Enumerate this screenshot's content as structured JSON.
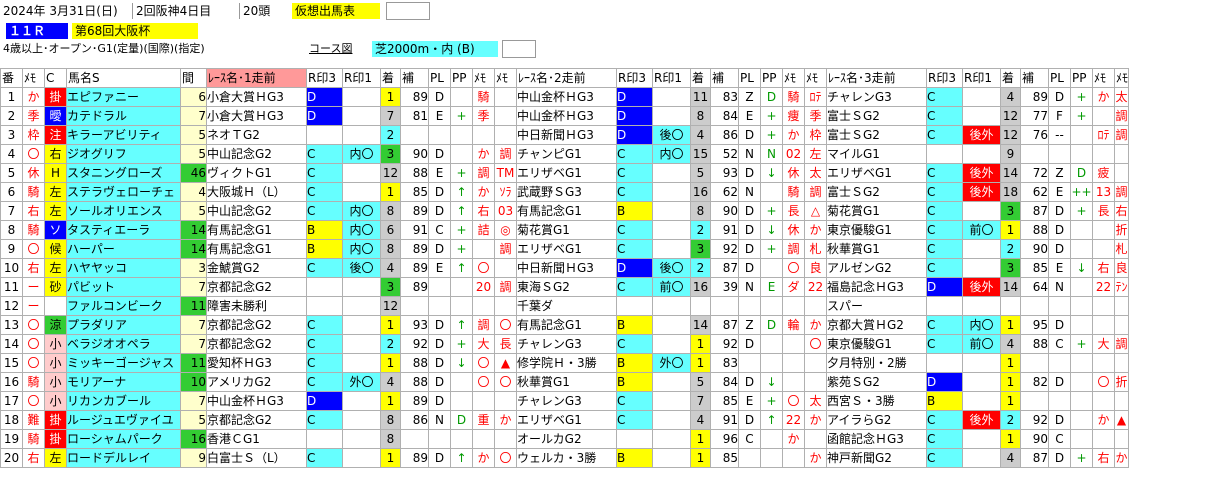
{
  "header": {
    "line1": {
      "date": "2024年  3月31日(日)",
      "meeting": "2回阪神4日目",
      "heads": "20頭",
      "card_type": "仮想出馬表"
    },
    "line2": {
      "race_no": "１１Ｒ",
      "race_name": "第68回大阪杯"
    },
    "line3": {
      "conditions": "4歳以上･オープン･G1(定量)(国際)(指定)",
      "course_label": "コース図",
      "course": "芝2000m・内 (B)"
    }
  },
  "columns": [
    "番",
    "ﾒﾓ",
    "C",
    "馬名S",
    "間",
    "ﾚｰｽ名･1走前",
    "R印3",
    "R印1",
    "着",
    "補",
    "PL",
    "PP",
    "ﾒﾓ",
    "ﾒﾓ",
    "ﾚｰｽ名･2走前",
    "R印3",
    "R印1",
    "着",
    "補",
    "PL",
    "PP",
    "ﾒﾓ",
    "ﾒﾓ",
    "ﾚｰｽ名･3走前",
    "R印3",
    "R印1",
    "着",
    "補",
    "PL",
    "PP",
    "ﾒﾓ",
    "ﾒﾓ"
  ],
  "rows": [
    {
      "no": "1",
      "memo": "か",
      "c": "掛",
      "name": "エピファニー",
      "gap": "6",
      "r1": {
        "race": "小倉大賞ＨG3",
        "ri3": "D",
        "ri1": "",
        "pos": "1",
        "ho": "89",
        "pl": "D",
        "pp": "",
        "m1": "騎",
        "m2": ""
      },
      "r2": {
        "race": "中山金杯ＨG3",
        "ri3": "D",
        "ri1": "",
        "pos": "11",
        "ho": "83",
        "pl": "Z",
        "pp": "D",
        "m1": "騎",
        "m2": "ﾛﾃ"
      },
      "r3": {
        "race": "チャレンG3",
        "ri3": "C",
        "ri1": "",
        "pos": "4",
        "ho": "89",
        "pl": "D",
        "pp": "+",
        "m1": "か",
        "m2": "太"
      }
    },
    {
      "no": "2",
      "memo": "季",
      "c": "曖",
      "name": "カテドラル",
      "gap": "7",
      "r1": {
        "race": "小倉大賞ＨG3",
        "ri3": "D",
        "ri1": "",
        "pos": "7",
        "ho": "81",
        "pl": "E",
        "pp": "+",
        "m1": "季",
        "m2": ""
      },
      "r2": {
        "race": "中山金杯ＨG3",
        "ri3": "D",
        "ri1": "",
        "pos": "8",
        "ho": "84",
        "pl": "E",
        "pp": "+",
        "m1": "痩",
        "m2": "季"
      },
      "r3": {
        "race": "富士ＳG2",
        "ri3": "C",
        "ri1": "",
        "pos": "12",
        "ho": "77",
        "pl": "F",
        "pp": "+",
        "m1": "",
        "m2": "調"
      }
    },
    {
      "no": "3",
      "memo": "枠",
      "c": "注",
      "name": "キラーアビリティ",
      "gap": "5",
      "r1": {
        "race": "ネオＴG2",
        "ri3": "",
        "ri1": "",
        "pos": "2",
        "ho": "",
        "pl": "",
        "pp": "",
        "m1": "",
        "m2": ""
      },
      "r2": {
        "race": "中日新聞ＨG3",
        "ri3": "D",
        "ri1": "後〇",
        "pos": "4",
        "ho": "86",
        "pl": "D",
        "pp": "+",
        "m1": "か",
        "m2": "枠"
      },
      "r3": {
        "race": "富士ＳG2",
        "ri3": "C",
        "ri1": "後外",
        "pos": "12",
        "ho": "76",
        "pl": "--",
        "pp": "",
        "m1": "ﾛﾃ",
        "m2": "調"
      }
    },
    {
      "no": "4",
      "memo": "〇",
      "c": "右",
      "name": "ジオグリフ",
      "gap": "5",
      "r1": {
        "race": "中山記念G2",
        "ri3": "C",
        "ri1": "内〇",
        "pos": "3",
        "ho": "90",
        "pl": "D",
        "pp": "",
        "m1": "か",
        "m2": "調"
      },
      "r2": {
        "race": "チャンピG1",
        "ri3": "C",
        "ri1": "内〇",
        "pos": "15",
        "ho": "52",
        "pl": "N",
        "pp": "N",
        "m1": "02",
        "m2": "左"
      },
      "r3": {
        "race": "マイルG1",
        "ri3": "",
        "ri1": "",
        "pos": "9",
        "ho": "",
        "pl": "",
        "pp": "",
        "m1": "",
        "m2": ""
      }
    },
    {
      "no": "5",
      "memo": "休",
      "c": "H",
      "name": "スタニングローズ",
      "gap": "46",
      "r1": {
        "race": "ヴィクトG1",
        "ri3": "C",
        "ri1": "",
        "pos": "12",
        "ho": "88",
        "pl": "E",
        "pp": "+",
        "m1": "調",
        "m2": "TM"
      },
      "r2": {
        "race": "エリザベG1",
        "ri3": "C",
        "ri1": "",
        "pos": "5",
        "ho": "93",
        "pl": "D",
        "pp": "↓",
        "m1": "休",
        "m2": "太"
      },
      "r3": {
        "race": "エリザベG1",
        "ri3": "C",
        "ri1": "後外",
        "pos": "14",
        "ho": "72",
        "pl": "Z",
        "pp": "D",
        "m1": "疲",
        "m2": ""
      }
    },
    {
      "no": "6",
      "memo": "騎",
      "c": "左",
      "name": "ステラヴェローチェ",
      "gap": "4",
      "r1": {
        "race": "大阪城Ｈ（L）",
        "ri3": "C",
        "ri1": "",
        "pos": "1",
        "ho": "85",
        "pl": "D",
        "pp": "↑",
        "m1": "か",
        "m2": "ｿﾗ"
      },
      "r2": {
        "race": "武蔵野ＳG3",
        "ri3": "C",
        "ri1": "",
        "pos": "16",
        "ho": "62",
        "pl": "N",
        "pp": "",
        "m1": "騎",
        "m2": "調"
      },
      "r3": {
        "race": "富士ＳG2",
        "ri3": "C",
        "ri1": "後外",
        "pos": "18",
        "ho": "62",
        "pl": "E",
        "pp": "++",
        "m1": "13",
        "m2": "調"
      }
    },
    {
      "no": "7",
      "memo": "右",
      "c": "左",
      "name": "ソールオリエンス",
      "gap": "5",
      "r1": {
        "race": "中山記念G2",
        "ri3": "C",
        "ri1": "内〇",
        "pos": "8",
        "ho": "89",
        "pl": "D",
        "pp": "↑",
        "m1": "右",
        "m2": "03"
      },
      "r2": {
        "race": "有馬記念G1",
        "ri3": "B",
        "ri1": "",
        "pos": "8",
        "ho": "90",
        "pl": "D",
        "pp": "+",
        "m1": "長",
        "m2": "△"
      },
      "r3": {
        "race": "菊花賞G1",
        "ri3": "C",
        "ri1": "",
        "pos": "3",
        "ho": "87",
        "pl": "D",
        "pp": "+",
        "m1": "長",
        "m2": "右"
      }
    },
    {
      "no": "8",
      "memo": "騎",
      "c": "ソ",
      "name": "タスティエーラ",
      "gap": "14",
      "r1": {
        "race": "有馬記念G1",
        "ri3": "B",
        "ri1": "内〇",
        "pos": "6",
        "ho": "91",
        "pl": "C",
        "pp": "+",
        "m1": "詰",
        "m2": "◎"
      },
      "r2": {
        "race": "菊花賞G1",
        "ri3": "C",
        "ri1": "",
        "pos": "2",
        "ho": "91",
        "pl": "D",
        "pp": "↓",
        "m1": "休",
        "m2": "か"
      },
      "r3": {
        "race": "東京優駿G1",
        "ri3": "C",
        "ri1": "前〇",
        "pos": "1",
        "ho": "88",
        "pl": "D",
        "pp": "",
        "m1": "",
        "m2": "折"
      }
    },
    {
      "no": "9",
      "memo": "〇",
      "c": "候",
      "name": "ハーパー",
      "gap": "14",
      "r1": {
        "race": "有馬記念G1",
        "ri3": "B",
        "ri1": "内〇",
        "pos": "8",
        "ho": "89",
        "pl": "D",
        "pp": "+",
        "m1": "",
        "m2": "調"
      },
      "r2": {
        "race": "エリザベG1",
        "ri3": "C",
        "ri1": "",
        "pos": "3",
        "ho": "92",
        "pl": "D",
        "pp": "+",
        "m1": "調",
        "m2": "札"
      },
      "r3": {
        "race": "秋華賞G1",
        "ri3": "C",
        "ri1": "",
        "pos": "2",
        "ho": "90",
        "pl": "D",
        "pp": "",
        "m1": "",
        "m2": "札"
      }
    },
    {
      "no": "10",
      "memo": "右",
      "c": "左",
      "name": "ハヤヤッコ",
      "gap": "3",
      "r1": {
        "race": "金鯱賞G2",
        "ri3": "C",
        "ri1": "後〇",
        "pos": "4",
        "ho": "89",
        "pl": "E",
        "pp": "↑",
        "m1": "〇",
        "m2": ""
      },
      "r2": {
        "race": "中日新聞ＨG3",
        "ri3": "D",
        "ri1": "後〇",
        "pos": "2",
        "ho": "87",
        "pl": "D",
        "pp": "",
        "m1": "〇",
        "m2": "良"
      },
      "r3": {
        "race": "アルゼンG2",
        "ri3": "C",
        "ri1": "",
        "pos": "3",
        "ho": "85",
        "pl": "E",
        "pp": "↓",
        "m1": "右",
        "m2": "良"
      }
    },
    {
      "no": "11",
      "memo": "ー",
      "c": "砂",
      "name": "パビット",
      "gap": "7",
      "r1": {
        "race": "京都記念G2",
        "ri3": "",
        "ri1": "",
        "pos": "3",
        "ho": "89",
        "pl": "",
        "pp": "",
        "m1": "20",
        "m2": "調"
      },
      "r2": {
        "race": "東海ＳG2",
        "ri3": "C",
        "ri1": "前〇",
        "pos": "16",
        "ho": "39",
        "pl": "N",
        "pp": "E",
        "m1": "ダ",
        "m2": "22"
      },
      "r3": {
        "race": "福島記念ＨG3",
        "ri3": "D",
        "ri1": "後外",
        "pos": "14",
        "ho": "64",
        "pl": "N",
        "pp": "",
        "m1": "22",
        "m2": "ﾃﾝ"
      }
    },
    {
      "no": "12",
      "memo": "ー",
      "c": "",
      "name": "ファルコンビーク",
      "gap": "11",
      "r1": {
        "race": "障害未勝利",
        "ri3": "",
        "ri1": "",
        "pos": "12",
        "ho": "",
        "pl": "",
        "pp": "",
        "m1": "",
        "m2": ""
      },
      "r2": {
        "race": "千葉ダ",
        "ri3": "",
        "ri1": "",
        "pos": "",
        "ho": "",
        "pl": "",
        "pp": "",
        "m1": "",
        "m2": ""
      },
      "r3": {
        "race": "スパー",
        "ri3": "",
        "ri1": "",
        "pos": "",
        "ho": "",
        "pl": "",
        "pp": "",
        "m1": "",
        "m2": ""
      }
    },
    {
      "no": "13",
      "memo": "〇",
      "c": "涼",
      "name": "プラダリア",
      "gap": "7",
      "r1": {
        "race": "京都記念G2",
        "ri3": "C",
        "ri1": "",
        "pos": "1",
        "ho": "93",
        "pl": "D",
        "pp": "↑",
        "m1": "調",
        "m2": "〇"
      },
      "r2": {
        "race": "有馬記念G1",
        "ri3": "B",
        "ri1": "",
        "pos": "14",
        "ho": "87",
        "pl": "Z",
        "pp": "D",
        "m1": "輪",
        "m2": "か"
      },
      "r3": {
        "race": "京都大賞ＨG2",
        "ri3": "C",
        "ri1": "内〇",
        "pos": "1",
        "ho": "95",
        "pl": "D",
        "pp": "",
        "m1": "",
        "m2": ""
      }
    },
    {
      "no": "14",
      "memo": "〇",
      "c": "小",
      "name": "ベラジオオペラ",
      "gap": "7",
      "r1": {
        "race": "京都記念G2",
        "ri3": "C",
        "ri1": "",
        "pos": "2",
        "ho": "92",
        "pl": "D",
        "pp": "+",
        "m1": "大",
        "m2": "長"
      },
      "r2": {
        "race": "チャレンG3",
        "ri3": "C",
        "ri1": "",
        "pos": "1",
        "ho": "92",
        "pl": "D",
        "pp": "",
        "m1": "",
        "m2": "〇"
      },
      "r3": {
        "race": "東京優駿G1",
        "ri3": "C",
        "ri1": "前〇",
        "pos": "4",
        "ho": "88",
        "pl": "C",
        "pp": "+",
        "m1": "大",
        "m2": "調"
      }
    },
    {
      "no": "15",
      "memo": "〇",
      "c": "小",
      "name": "ミッキーゴージャス",
      "gap": "11",
      "r1": {
        "race": "愛知杯ＨG3",
        "ri3": "C",
        "ri1": "",
        "pos": "1",
        "ho": "88",
        "pl": "D",
        "pp": "↓",
        "m1": "〇",
        "m2": "▲"
      },
      "r2": {
        "race": "修学院Ｈ・3勝",
        "ri3": "B",
        "ri1": "外〇",
        "pos": "1",
        "ho": "83",
        "pl": "",
        "pp": "",
        "m1": "",
        "m2": ""
      },
      "r3": {
        "race": "夕月特別・2勝",
        "ri3": "",
        "ri1": "",
        "pos": "1",
        "ho": "",
        "pl": "",
        "pp": "",
        "m1": "",
        "m2": ""
      }
    },
    {
      "no": "16",
      "memo": "騎",
      "c": "小",
      "name": "モリアーナ",
      "gap": "10",
      "r1": {
        "race": "アメリカG2",
        "ri3": "C",
        "ri1": "外〇",
        "pos": "4",
        "ho": "88",
        "pl": "D",
        "pp": "",
        "m1": "〇",
        "m2": "〇"
      },
      "r2": {
        "race": "秋華賞G1",
        "ri3": "B",
        "ri1": "",
        "pos": "5",
        "ho": "84",
        "pl": "D",
        "pp": "↓",
        "m1": "",
        "m2": ""
      },
      "r3": {
        "race": "紫苑ＳG2",
        "ri3": "D",
        "ri1": "",
        "pos": "1",
        "ho": "82",
        "pl": "D",
        "pp": "",
        "m1": "〇",
        "m2": "折"
      }
    },
    {
      "no": "17",
      "memo": "〇",
      "c": "小",
      "name": "リカンカブール",
      "gap": "7",
      "r1": {
        "race": "中山金杯ＨG3",
        "ri3": "D",
        "ri1": "",
        "pos": "1",
        "ho": "89",
        "pl": "D",
        "pp": "",
        "m1": "",
        "m2": ""
      },
      "r2": {
        "race": "チャレンG3",
        "ri3": "C",
        "ri1": "",
        "pos": "7",
        "ho": "85",
        "pl": "E",
        "pp": "+",
        "m1": "〇",
        "m2": "太"
      },
      "r3": {
        "race": "西宮Ｓ・3勝",
        "ri3": "B",
        "ri1": "",
        "pos": "1",
        "ho": "",
        "pl": "",
        "pp": "",
        "m1": "",
        "m2": ""
      }
    },
    {
      "no": "18",
      "memo": "難",
      "c": "掛",
      "name": "ルージュエヴァイユ",
      "gap": "5",
      "r1": {
        "race": "京都記念G2",
        "ri3": "C",
        "ri1": "",
        "pos": "8",
        "ho": "86",
        "pl": "N",
        "pp": "D",
        "m1": "重",
        "m2": "か"
      },
      "r2": {
        "race": "エリザベG1",
        "ri3": "C",
        "ri1": "",
        "pos": "4",
        "ho": "91",
        "pl": "D",
        "pp": "↑",
        "m1": "22",
        "m2": "か"
      },
      "r3": {
        "race": "アイラらG2",
        "ri3": "C",
        "ri1": "後外",
        "pos": "2",
        "ho": "92",
        "pl": "D",
        "pp": "",
        "m1": "か",
        "m2": "▲"
      }
    },
    {
      "no": "19",
      "memo": "騎",
      "c": "掛",
      "name": "ローシャムパーク",
      "gap": "16",
      "r1": {
        "race": "香港ＣG1",
        "ri3": "",
        "ri1": "",
        "pos": "8",
        "ho": "",
        "pl": "",
        "pp": "",
        "m1": "",
        "m2": ""
      },
      "r2": {
        "race": "オールカG2",
        "ri3": "",
        "ri1": "",
        "pos": "1",
        "ho": "96",
        "pl": "C",
        "pp": "",
        "m1": "か",
        "m2": ""
      },
      "r3": {
        "race": "函館記念ＨG3",
        "ri3": "C",
        "ri1": "",
        "pos": "1",
        "ho": "90",
        "pl": "C",
        "pp": "",
        "m1": "",
        "m2": ""
      }
    },
    {
      "no": "20",
      "memo": "右",
      "c": "左",
      "name": "ロードデルレイ",
      "gap": "9",
      "r1": {
        "race": "白富士Ｓ（L）",
        "ri3": "C",
        "ri1": "",
        "pos": "1",
        "ho": "89",
        "pl": "D",
        "pp": "↑",
        "m1": "か",
        "m2": "〇"
      },
      "r2": {
        "race": "ウェルカ・3勝",
        "ri3": "B",
        "ri1": "",
        "pos": "1",
        "ho": "85",
        "pl": "",
        "pp": "",
        "m1": "",
        "m2": "か"
      },
      "r3": {
        "race": "神戸新聞G2",
        "ri3": "C",
        "ri1": "",
        "pos": "4",
        "ho": "87",
        "pl": "D",
        "pp": "+",
        "m1": "右",
        "m2": "か"
      }
    }
  ]
}
